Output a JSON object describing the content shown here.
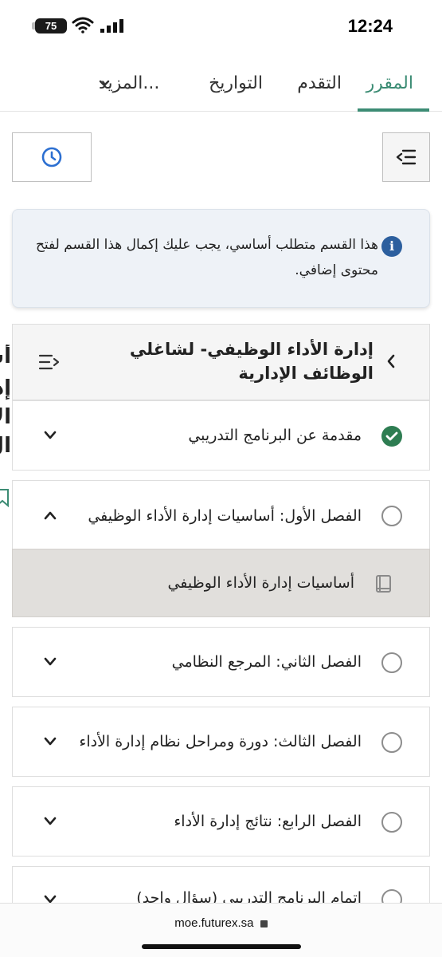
{
  "status_bar": {
    "time": "12:24",
    "battery": "75"
  },
  "tabs": [
    {
      "label": "المقرر",
      "active": true
    },
    {
      "label": "التقدم",
      "active": false
    },
    {
      "label": "التواريخ",
      "active": false
    },
    {
      "label": "المزيد...",
      "active": false
    }
  ],
  "toolbar": {
    "clock_icon": "clock-icon",
    "outline_icon": "collapse-outline-icon"
  },
  "alert": {
    "icon": "info-icon",
    "text": "هذا القسم متطلب أساسي، يجب عليك إكمال هذا القسم لفتح محتوى إضافي."
  },
  "section": {
    "title": "إدارة الأداء الوظيفي- لشاغلي الوظائف الإدارية"
  },
  "units": [
    {
      "label": "مقدمة عن البرنامج التدريبي",
      "status": "complete"
    },
    {
      "label": "الفصل الأول: أساسيات إدارة الأداء الوظيفي",
      "status": "incomplete",
      "expanded": true
    },
    {
      "label": "الفصل الثاني: المرجع النظامي",
      "status": "incomplete"
    },
    {
      "label": "الفصل الثالث: دورة ومراحل نظام إدارة الأداء",
      "status": "incomplete"
    },
    {
      "label": "الفصل الرابع: نتائج إدارة الأداء",
      "status": "incomplete"
    },
    {
      "label": "اتمام البرنامج التدريبي (سؤال واحد)",
      "status": "incomplete"
    }
  ],
  "subsection": {
    "label": "أساسيات إدارة الأداء الوظيفي",
    "icon": "book-icon"
  },
  "colors": {
    "accent": "#3c8c74",
    "complete": "#2e7d52",
    "info": "#2c5f9e"
  },
  "url_bar": {
    "url": "moe.futurex.sa"
  }
}
